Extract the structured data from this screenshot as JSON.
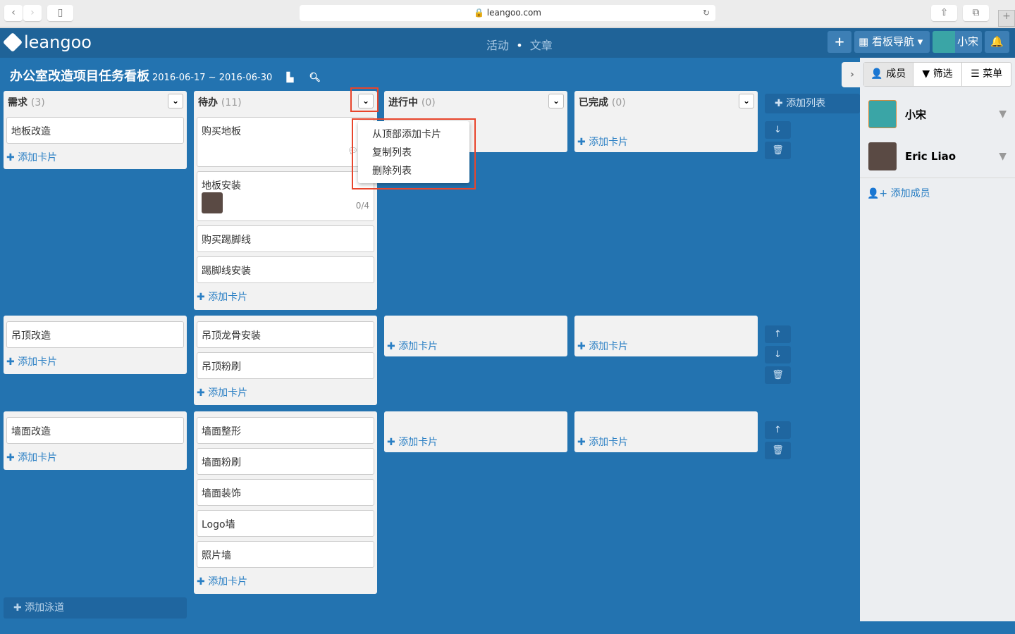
{
  "browser": {
    "url": "leangoo.com"
  },
  "header": {
    "logo": "leangoo",
    "nav": [
      "活动",
      "文章"
    ],
    "nav_sep": "•",
    "add": "+",
    "board_nav": "看板导航 ▾",
    "user": "小宋"
  },
  "board": {
    "title": "办公室改造项目任务看板",
    "dates": "2016-06-17 ~ 2016-06-30"
  },
  "columns": [
    {
      "name": "需求",
      "count": "(3)"
    },
    {
      "name": "待办",
      "count": "(11)"
    },
    {
      "name": "进行中",
      "count": "(0)"
    },
    {
      "name": "已完成",
      "count": "(0)"
    }
  ],
  "add_card": "添加卡片",
  "add_list": "添加列表",
  "add_lane": "添加泳道",
  "lanes": [
    {
      "cols": [
        [
          {
            "t": "地板改造"
          }
        ],
        [
          {
            "t": "购买地板",
            "comment": true
          },
          {
            "t": "地板安装",
            "avatar": true,
            "check": "0/4"
          },
          {
            "t": "购买踢脚线"
          },
          {
            "t": "踢脚线安装"
          }
        ],
        [],
        []
      ]
    },
    {
      "cols": [
        [
          {
            "t": "吊顶改造"
          }
        ],
        [
          {
            "t": "吊顶龙骨安装"
          },
          {
            "t": "吊顶粉刷"
          }
        ],
        [],
        []
      ]
    },
    {
      "cols": [
        [
          {
            "t": "墙面改造"
          }
        ],
        [
          {
            "t": "墙面整形"
          },
          {
            "t": "墙面粉刷"
          },
          {
            "t": "墙面装饰"
          },
          {
            "t": "Logo墙"
          },
          {
            "t": "照片墙"
          }
        ],
        [],
        []
      ]
    }
  ],
  "list_menu": [
    "从顶部添加卡片",
    "复制列表",
    "删除列表"
  ],
  "sidebar": {
    "tabs": [
      "成员",
      "筛选",
      "菜单"
    ],
    "members": [
      "小宋",
      "Eric Liao"
    ],
    "add_member": "添加成员"
  },
  "colors": {
    "topbar": "#1f6398",
    "board": "#2373b0",
    "highlight": "#e8452c",
    "link": "#2a7fc4"
  }
}
